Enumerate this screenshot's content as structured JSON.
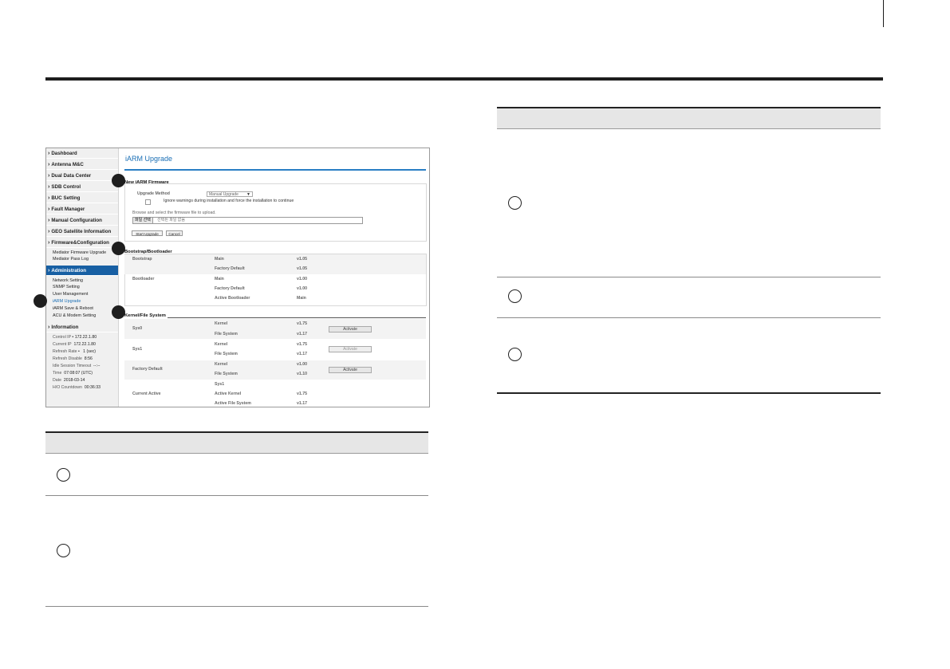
{
  "ui": {
    "sidebar": {
      "nav": [
        {
          "label": "Dashboard"
        },
        {
          "label": "Antenna M&C"
        },
        {
          "label": "Dual Data Center"
        },
        {
          "label": "SDB Control"
        },
        {
          "label": "BUC Setting"
        },
        {
          "label": "Fault Manager"
        },
        {
          "label": "Manual Configuration"
        },
        {
          "label": "GEO Satellite Information"
        },
        {
          "label": "Firmware&Configuration"
        },
        {
          "label": "Administration"
        },
        {
          "label": "Information"
        }
      ],
      "firmware_sub": [
        "Mediator Firmware Upgrade",
        "Mediator Pass Log"
      ],
      "admin_sub": [
        "Network Setting",
        "SNMP Setting",
        "User Management",
        "iARM Upgrade",
        "iARM Save & Reboot",
        "ACU & Modem Setting"
      ],
      "info": [
        {
          "key": "Control IP",
          "value": "172.22.1.80"
        },
        {
          "key": "Current IP",
          "value": "172.22.1.80"
        },
        {
          "key": "Refresh Rate",
          "value": "1 (sec)"
        },
        {
          "key": "Refresh Disable",
          "value": "8:56"
        },
        {
          "key": "Idle Session Timeout",
          "value": "--:--"
        },
        {
          "key": "Time",
          "value": "07:08:07 (UTC)"
        },
        {
          "key": "Date",
          "value": "2018-03-14"
        },
        {
          "key": "H/O Countdown",
          "value": "00:36:33"
        }
      ]
    },
    "main": {
      "title": "iARM Upgrade",
      "new_firmware": {
        "heading": "New iARM Firmware",
        "method_label": "Upgrade Method",
        "method_value": "Manual Upgrade",
        "ignore_label": "Ignore warnings during installation and force the installation to continue",
        "browse_label": "Browse and select the firmware file to upload.",
        "file_button": "파일 선택",
        "file_status": "선택된 파일 없음",
        "start_button": "Start Upgrade",
        "cancel_button": "Cancel"
      },
      "bootstrap": {
        "heading": "Bootstrap/Bootloader",
        "rows": [
          {
            "group": "Bootstrap",
            "name": "Main",
            "value": "v1.05"
          },
          {
            "group": "",
            "name": "Factory Default",
            "value": "v1.05"
          },
          {
            "group": "Bootloader",
            "name": "Main",
            "value": "v1.00"
          },
          {
            "group": "",
            "name": "Factory Default",
            "value": "v1.00"
          },
          {
            "group": "",
            "name": "Active Bootloader",
            "value": "Main"
          }
        ]
      },
      "kernel": {
        "heading": "Kernel/File System",
        "rows": [
          {
            "group": "Sys0",
            "name": "Kernel",
            "value": "v1.75"
          },
          {
            "group": "",
            "name": "File System",
            "value": "v1.17"
          },
          {
            "group": "Sys1",
            "name": "Kernel",
            "value": "v1.75"
          },
          {
            "group": "",
            "name": "File System",
            "value": "v1.17"
          },
          {
            "group": "Factory Default",
            "name": "Kernel",
            "value": "v1.00"
          },
          {
            "group": "",
            "name": "File System",
            "value": "v1.10"
          },
          {
            "group": "",
            "name": "Sys1",
            "value": ""
          },
          {
            "group": "Current Active",
            "name": "Active Kernel",
            "value": "v1.75"
          },
          {
            "group": "",
            "name": "Active File System",
            "value": "v1.17"
          }
        ],
        "activate_label": "Activate"
      }
    }
  },
  "colors": {
    "accent": "#1a6fb5",
    "nav_active": "#175fa3",
    "rule": "#1e1e1e",
    "table_head": "#e6e6e6"
  }
}
